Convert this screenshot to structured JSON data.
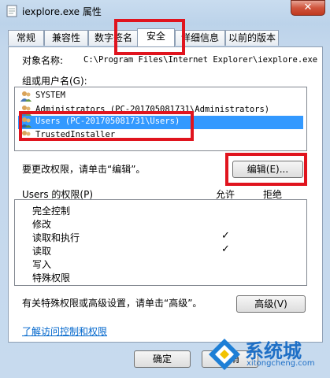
{
  "window": {
    "title": "iexplore.exe 属性",
    "close_symbol": "✕"
  },
  "tabs": [
    {
      "label": "常规"
    },
    {
      "label": "兼容性"
    },
    {
      "label": "数字签名"
    },
    {
      "label": "安全"
    },
    {
      "label": "详细信息"
    },
    {
      "label": "以前的版本"
    }
  ],
  "object": {
    "label": "对象名称:",
    "value": "C:\\Program Files\\Internet Explorer\\iexplore.exe"
  },
  "groups": {
    "label": "组或用户名(G):",
    "items": [
      {
        "name": "SYSTEM",
        "icon": "users-group-icon"
      },
      {
        "name": "Administrators (PC-201705081731\\Administrators)",
        "icon": "users-group-icon"
      },
      {
        "name": "Users (PC-201705081731\\Users)",
        "icon": "users-group-icon"
      },
      {
        "name": "TrustedInstaller",
        "icon": "users-group-icon"
      }
    ],
    "selected_index": 2
  },
  "change_hint": "要更改权限，请单击“编辑”。",
  "edit_button": "编辑(E)...",
  "permissions": {
    "label": "Users 的权限(P)",
    "allow_label": "允许",
    "deny_label": "拒绝",
    "rows": [
      {
        "name": "完全控制",
        "allow": false
      },
      {
        "name": "修改",
        "allow": false
      },
      {
        "name": "读取和执行",
        "allow": true
      },
      {
        "name": "读取",
        "allow": true
      },
      {
        "name": "写入",
        "allow": false
      },
      {
        "name": "特殊权限",
        "allow": false
      }
    ],
    "check_mark": "✓"
  },
  "advanced_hint": "有关特殊权限或高级设置，请单击“高级”。",
  "advanced_button": "高级(V)",
  "learn_link": "了解访问控制和权限",
  "footer": {
    "ok": "确定",
    "cancel": "取消"
  },
  "watermark": {
    "text": "系统城",
    "url": "xitongcheng.com"
  },
  "colors": {
    "highlight": "#e0141e",
    "selection": "#3399ff",
    "link": "#0066cc"
  }
}
